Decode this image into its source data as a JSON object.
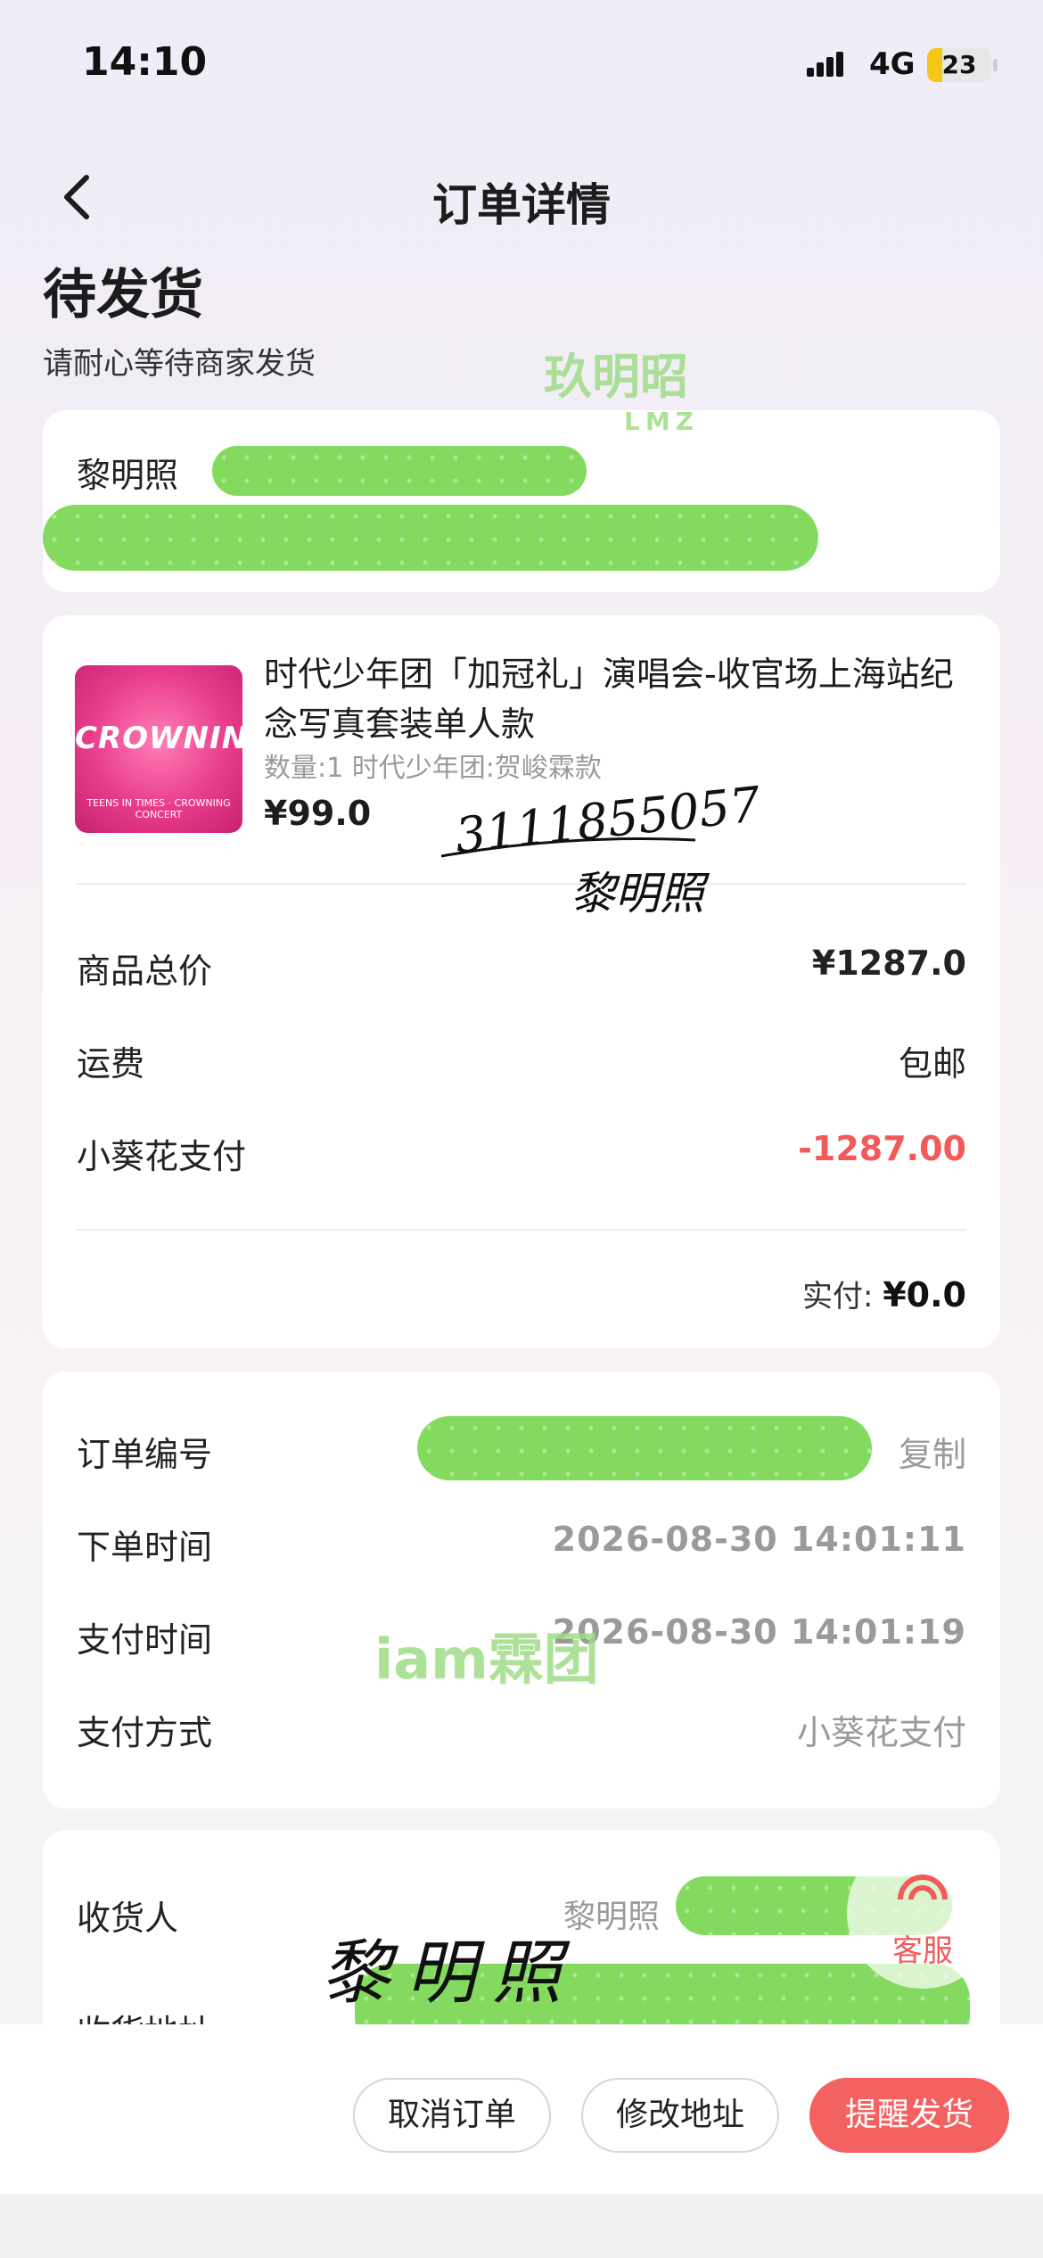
{
  "status_bar": {
    "time": "14:10",
    "network": "4G",
    "battery": "23",
    "battery_level": 0.23
  },
  "nav": {
    "title": "订单详情"
  },
  "order_status": {
    "title": "待发货",
    "subtitle": "请耐心等待商家发货"
  },
  "address": {
    "name": "黎明照"
  },
  "product": {
    "thumb_text": "CROWNING",
    "thumb_sub": "TEENS IN TIMES · CROWNING CONCERT",
    "title": "时代少年团「加冠礼」演唱会-收官场上海站纪念写真套装单人款",
    "variant": "数量:1 时代少年团:贺峻霖款",
    "price": "¥99.0"
  },
  "summary": {
    "total_label": "商品总价",
    "total_value": "¥1287.0",
    "shipping_label": "运费",
    "shipping_value": "包邮",
    "pay_label": "小葵花支付",
    "pay_value": "-1287.00",
    "paid_label": "实付:",
    "paid_value": "¥0.0"
  },
  "info": {
    "order_no_label": "订单编号",
    "copy_label": "复制",
    "order_time_label": "下单时间",
    "order_time_value": "2026-08-30 14:01:11",
    "pay_time_label": "支付时间",
    "pay_time_value": "2026-08-30 14:01:19",
    "pay_method_label": "支付方式",
    "pay_method_value": "小葵花支付"
  },
  "receiver": {
    "receiver_label": "收货人",
    "receiver_value": "黎明照",
    "address_label": "收货地址"
  },
  "service": {
    "label": "客服"
  },
  "watermarks": {
    "top": "玖明昭",
    "top_sub": "LMZ",
    "middle": "iam霖团"
  },
  "signatures": {
    "name": "黎明照",
    "number": "3111855057"
  },
  "actions": {
    "cancel": "取消订单",
    "modify": "修改地址",
    "remind": "提醒发货"
  },
  "colors": {
    "accent": "#f46161",
    "redaction": "#7ed957"
  }
}
